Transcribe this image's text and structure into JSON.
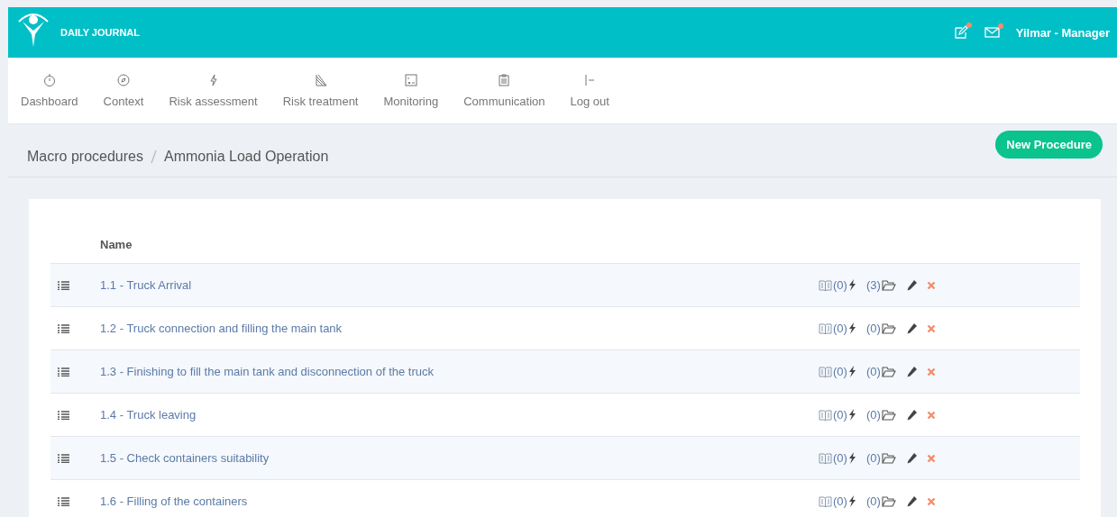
{
  "header": {
    "brand": "DAILY JOURNAL",
    "user": "Yilmar - Manager",
    "notifications": [
      {
        "kind": "edit",
        "unread": true
      },
      {
        "kind": "mail",
        "unread": true
      }
    ]
  },
  "nav": [
    {
      "label": "Dashboard"
    },
    {
      "label": "Context"
    },
    {
      "label": "Risk assessment"
    },
    {
      "label": "Risk treatment"
    },
    {
      "label": "Monitoring"
    },
    {
      "label": "Communication"
    },
    {
      "label": "Log out"
    }
  ],
  "breadcrumb": [
    "Macro procedures",
    "Ammonia Load Operation"
  ],
  "new_button": "New Procedure",
  "table": {
    "columns": [
      "Name"
    ],
    "rows": [
      {
        "name": "1.1 - Truck Arrival",
        "documents": "(0)",
        "risks": "(3)"
      },
      {
        "name": "1.2 - Truck connection and filling the main tank",
        "documents": "(0)",
        "risks": "(0)"
      },
      {
        "name": "1.3 - Finishing to fill the main tank and disconnection of the truck",
        "documents": "(0)",
        "risks": "(0)"
      },
      {
        "name": "1.4 - Truck leaving",
        "documents": "(0)",
        "risks": "(0)"
      },
      {
        "name": "1.5 - Check containers suitability",
        "documents": "(0)",
        "risks": "(0)"
      },
      {
        "name": "1.6 - Filling of the containers",
        "documents": "(0)",
        "risks": "(0)"
      }
    ]
  }
}
